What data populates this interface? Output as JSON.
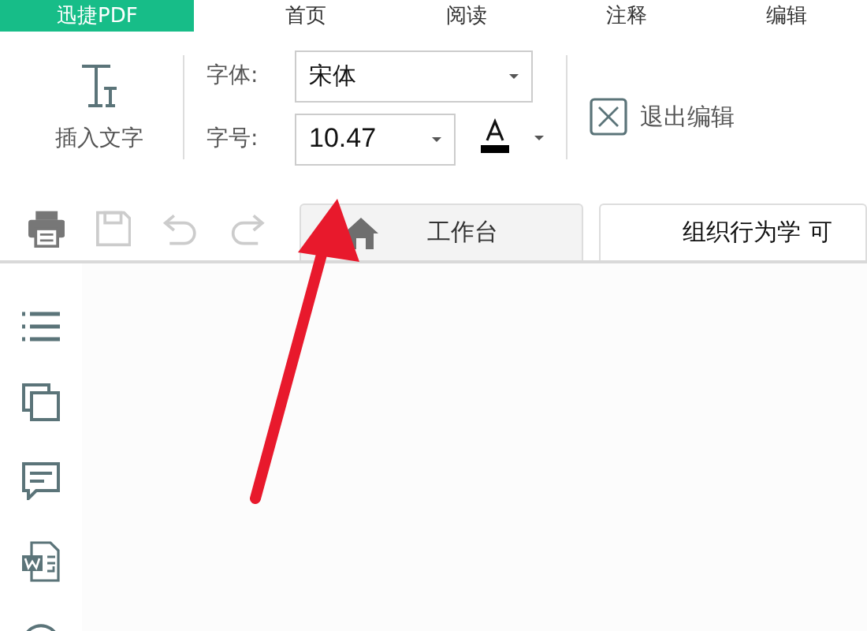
{
  "menu_tabs": [
    {
      "label": "迅捷PDF",
      "selected": true
    },
    {
      "label": "首页",
      "selected": false
    },
    {
      "label": "阅读",
      "selected": false
    },
    {
      "label": "注释",
      "selected": false
    },
    {
      "label": "编辑",
      "selected": false
    }
  ],
  "toolbar": {
    "insert_text": "插入文字",
    "font_label": "字体:",
    "font_value": "宋体",
    "size_label": "字号:",
    "size_value": "10.47",
    "exit_edit": "退出编辑"
  },
  "doc_tabs": [
    {
      "label": "工作台",
      "kind": "home",
      "selected": false
    },
    {
      "label": "组织行为学 可",
      "kind": "doc",
      "selected": true
    }
  ]
}
